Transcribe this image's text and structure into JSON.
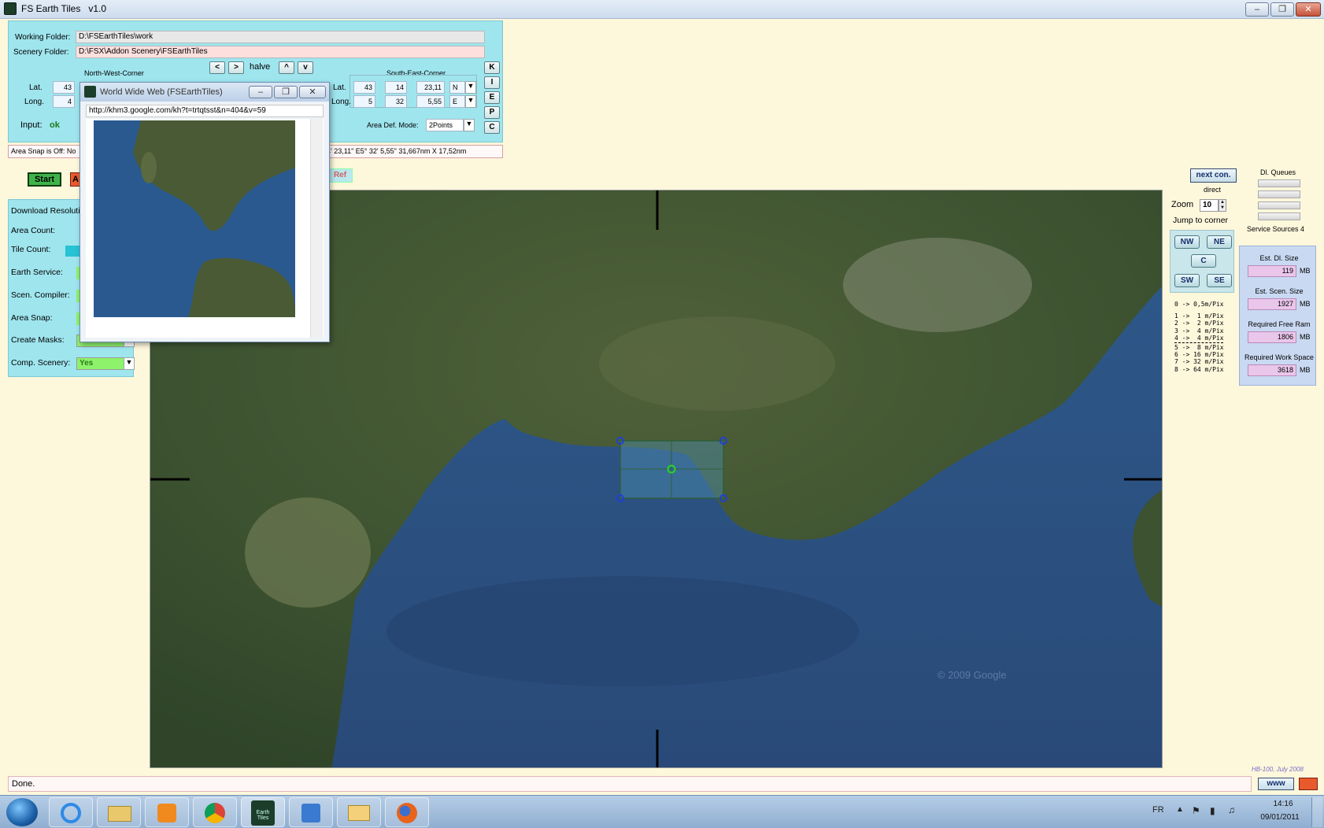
{
  "app": {
    "title": "FS Earth Tiles",
    "version": "v1.0",
    "window_buttons": {
      "minimize": "‒",
      "restore": "❐",
      "close": "✕"
    }
  },
  "folders": {
    "working_label": "Working Folder:",
    "working_value": "D:\\FSEarthTiles\\work",
    "scenery_label": "Scenery Folder:",
    "scenery_value": "D:\\FSX\\Addon Scenery\\FSEarthTiles"
  },
  "nav": {
    "left": "<",
    "right": ">",
    "halve": "halve",
    "up": "^",
    "down": "v"
  },
  "nw_corner": {
    "title": "North-West-Corner",
    "lat_label": "Lat.",
    "long_label": "Long.",
    "lat_deg": "43",
    "long_deg": "4"
  },
  "se_corner": {
    "title": "South-East-Corner",
    "lat_label": "Lat.",
    "long_label": "Long.",
    "lat_deg": "43",
    "lat_min": "14",
    "lat_sec": "23,11",
    "lat_dir": "N",
    "long_deg": "5",
    "long_min": "32",
    "long_sec": "5,55",
    "long_dir": "E"
  },
  "input": {
    "label": "Input:",
    "value": "ok"
  },
  "area_def": {
    "label": "Area Def. Mode:",
    "value": "2Points"
  },
  "side_buttons": [
    "K",
    "I",
    "E",
    "P",
    "C"
  ],
  "snap_status": {
    "left": "Area Snap is Off:  No",
    "right": "4' 23,11\"   E5° 32' 5,55\"    31,667nm X 17,52nm"
  },
  "actions": {
    "start": "Start",
    "abort": "A",
    "ref": "Ref"
  },
  "left_panel": {
    "rows": [
      {
        "label": "Download Resoluti"
      },
      {
        "label": "Area Count:"
      },
      {
        "label": "Tile Count:"
      },
      {
        "label": "Earth Service:"
      },
      {
        "label": "Scen. Compiler:"
      },
      {
        "label": "Area Snap:"
      },
      {
        "label": "Create Masks:",
        "value": "Yes"
      },
      {
        "label": "Comp. Scenery:",
        "value": "Yes"
      }
    ]
  },
  "www_window": {
    "title": "World Wide Web   (FSEarthTiles)",
    "url": "http://khm3.google.com/kh?t=trtqtsst&n=404&v=59"
  },
  "right_panel": {
    "next_con": "next con.",
    "direct": "direct",
    "zoom_label": "Zoom",
    "zoom_value": "10",
    "dl_queues": "Dl. Queues",
    "service_sources": "Service Sources 4",
    "jump_title": "Jump to corner",
    "jump_buttons": {
      "nw": "NW",
      "ne": "NE",
      "c": "C",
      "sw": "SW",
      "se": "SE"
    },
    "resolution_lines": [
      "0 -> 0,5m/Pix",
      "1 ->  1 m/Pix",
      "2 ->  2 m/Pix",
      "3 ->  4 m/Pix",
      "4 ->  4 m/Pix",
      "5 ->  8 m/Pix",
      "6 -> 16 m/Pix",
      "7 -> 32 m/Pix",
      "8 -> 64 m/Pix"
    ]
  },
  "sizes": {
    "dl_label": "Est. Dl. Size",
    "dl_value": "119",
    "scen_label": "Est. Scen. Size",
    "scen_value": "1927",
    "ram_label": "Required Free Ram",
    "ram_value": "1806",
    "work_label": "Required Work Space",
    "work_value": "3618",
    "unit": "MB"
  },
  "credit": "HB-100,  July 2008",
  "status": {
    "text": "Done.",
    "www_button": "www"
  },
  "map_watermark": "© 2009 Google",
  "taskbar": {
    "lang": "FR",
    "time": "14:16",
    "date": "09/01/2011",
    "earth_tiles_label": "Earth Tiles",
    "apps": [
      "start-orb-icon",
      "ie-icon",
      "explorer-icon",
      "media-player-icon",
      "chrome-icon",
      "earth-tiles-icon",
      "fsx-icon",
      "mail-icon",
      "firefox-icon"
    ]
  }
}
